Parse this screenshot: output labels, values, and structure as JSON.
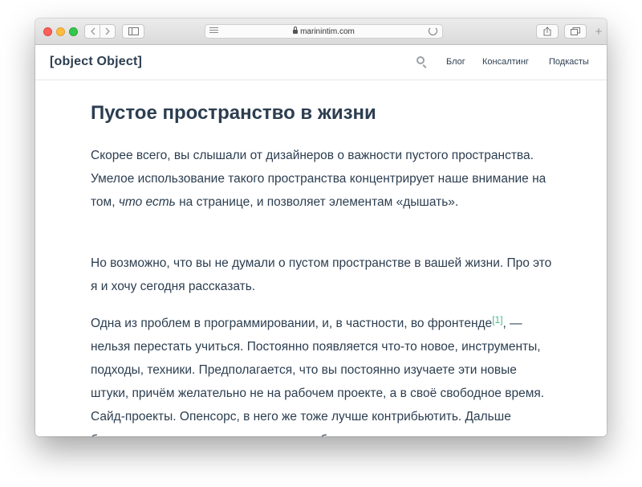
{
  "browser": {
    "address": "marinintim.com"
  },
  "site": {
    "logo": "[object Object]",
    "nav": [
      "Блог",
      "Консалтинг",
      "Подкасты"
    ]
  },
  "article": {
    "title": "Пустое пространство в жизни",
    "p1_a": "Скорее всего, вы слышали от дизайнеров о важности пустого пространства. Умелое использование такого пространства концентрирует наше внимание на том, ",
    "p1_em": "что есть",
    "p1_b": " на странице, и позволяет элементам «дышать».",
    "p2": "Но возможно, что вы не думали о пустом пространстве в вашей жизни. Про это я и хочу сегодня рассказать.",
    "p3_a": "Одна из проблем в программировании, и, в частности, во фронтенде",
    "p3_fn": "[1]",
    "p3_b": ", — нельзя перестать учиться. Постоянно появляется что-то новое, инструменты, подходы, техники. Предполагается, что вы постоянно изучаете эти новые штуки, причём желательно не на рабочем проекте, а в своё свободное время. Сайд-проекты. Опенсорс, в него же тоже лучше контрибьютить. Дальше больше — стоит ходить на митапы, пообщаться с"
  }
}
